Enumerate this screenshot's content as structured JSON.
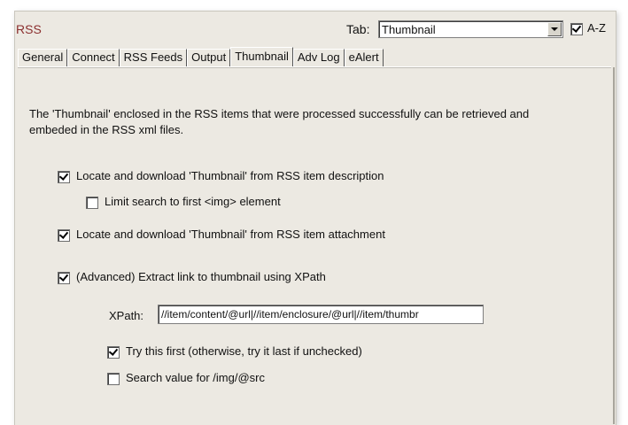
{
  "header": {
    "title": "RSS",
    "tab_label": "Tab:",
    "tab_select_value": "Thumbnail",
    "az_label": "A-Z",
    "az_checked": true
  },
  "tabs": [
    {
      "label": "General"
    },
    {
      "label": "Connect"
    },
    {
      "label": "RSS Feeds"
    },
    {
      "label": "Output"
    },
    {
      "label": "Thumbnail"
    },
    {
      "label": "Adv Log"
    },
    {
      "label": "eAlert"
    }
  ],
  "active_tab": "Thumbnail",
  "thumbnail": {
    "description": "The 'Thumbnail' enclosed in the RSS items that were processed successfully can be retrieved and embeded in the RSS xml files.",
    "options": {
      "locate_description": {
        "label": "Locate and download 'Thumbnail' from RSS item description",
        "checked": true
      },
      "limit_img": {
        "label": "Limit search to first <img> element",
        "checked": false
      },
      "locate_attachment": {
        "label": "Locate and download 'Thumbnail' from RSS item attachment",
        "checked": true
      },
      "advanced_xpath": {
        "label": "(Advanced) Extract link to thumbnail using XPath",
        "checked": true
      },
      "try_first": {
        "label": "Try this first (otherwise, try it last if unchecked)",
        "checked": true
      },
      "search_img_src": {
        "label": "Search value for /img/@src",
        "checked": false
      }
    },
    "xpath_label": "XPath:",
    "xpath_value": "//item/content/@url|//item/enclosure/@url|//item/thumbr"
  }
}
